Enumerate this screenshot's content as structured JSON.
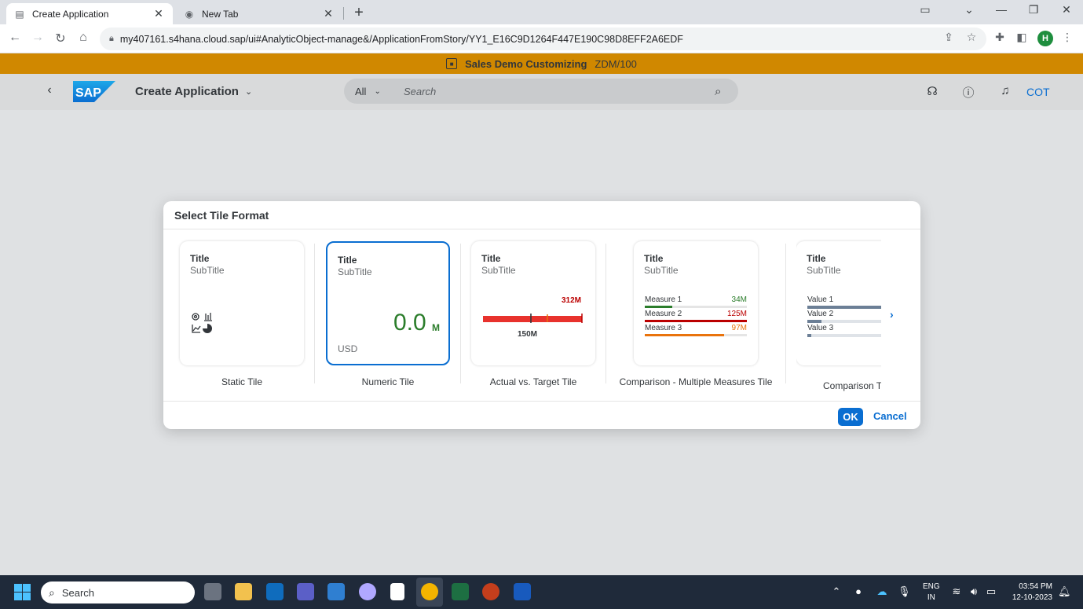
{
  "browser": {
    "tabs": [
      {
        "label": "Create Application",
        "active": true
      },
      {
        "label": "New Tab",
        "active": false
      }
    ],
    "url": "my407161.s4hana.cloud.sap/ui#AnalyticObject-manage&/ApplicationFromStory/YY1_E16C9D1264F447E190C98D8EFF2A6EDF",
    "profile_initial": "H"
  },
  "banner": {
    "system_name": "Sales Demo Customizing",
    "client": "ZDM/100"
  },
  "shell": {
    "app_title": "Create Application",
    "search_scope": "All",
    "search_placeholder": "Search",
    "user_initials": "COT"
  },
  "dialog": {
    "title": "Select Tile Format",
    "ok_label": "OK",
    "cancel_label": "Cancel",
    "tiles": [
      {
        "title": "Title",
        "subtitle": "SubTitle",
        "caption": "Static Tile"
      },
      {
        "title": "Title",
        "subtitle": "SubTitle",
        "caption": "Numeric Tile",
        "value": "0.0",
        "scale": "M",
        "currency": "USD",
        "selected": true
      },
      {
        "title": "Title",
        "subtitle": "SubTitle",
        "caption": "Actual vs. Target Tile",
        "target": "312M",
        "actual": "150M"
      },
      {
        "title": "Title",
        "subtitle": "SubTitle",
        "caption": "Comparison - Multiple Measures Tile",
        "measures": [
          {
            "label": "Measure 1",
            "value": "34M",
            "fraction": 0.27,
            "color": "#2b7d2b"
          },
          {
            "label": "Measure 2",
            "value": "125M",
            "fraction": 1.0,
            "color": "#bb0000"
          },
          {
            "label": "Measure 3",
            "value": "97M",
            "fraction": 0.78,
            "color": "#e9730c"
          }
        ]
      },
      {
        "title": "Title",
        "subtitle": "SubTitle",
        "caption": "Comparison T",
        "values": [
          {
            "label": "Value 1",
            "fraction": 1.0
          },
          {
            "label": "Value 2",
            "fraction": 0.18
          },
          {
            "label": "Value 3",
            "fraction": 0.05
          }
        ]
      }
    ]
  },
  "taskbar": {
    "search_placeholder": "Search",
    "language": "ENG",
    "region": "IN",
    "time": "03:54 PM",
    "date": "12-10-2023"
  },
  "colors": {
    "banner": "#d08800",
    "accent": "#0a6ed1",
    "positive": "#2b7d2b",
    "negative": "#bb0000"
  }
}
